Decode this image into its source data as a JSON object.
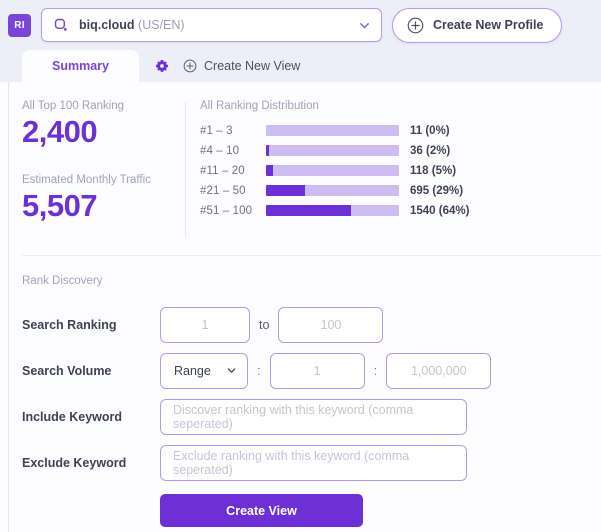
{
  "brand": {
    "logo_text": "RI",
    "accent": "#6d30d4",
    "accent_light": "#cdbdee",
    "border": "#b39ae8"
  },
  "topbar": {
    "profile_name": "biq.cloud",
    "profile_locale": "(US/EN)",
    "create_profile_label": "Create New Profile"
  },
  "tabs": {
    "active_label": "Summary",
    "create_view_label": "Create New View"
  },
  "summary": {
    "stats": [
      {
        "label": "All Top 100 Ranking",
        "value": "2,400"
      },
      {
        "label": "Estimated Monthly Traffic",
        "value": "5,507"
      }
    ]
  },
  "chart_data": {
    "type": "bar",
    "orientation": "horizontal",
    "title": "All Ranking Distribution",
    "xlabel": "",
    "ylabel": "",
    "grid": false,
    "legend": "none",
    "categories": [
      "#1 – 3",
      "#4 – 10",
      "#11 – 20",
      "#21 – 50",
      "#51 – 100"
    ],
    "values": [
      11,
      36,
      118,
      695,
      1540
    ],
    "percents": [
      0,
      2,
      5,
      29,
      64
    ],
    "total": 2400,
    "xlim": [
      0,
      100
    ],
    "value_labels": [
      "11 (0%)",
      "36 (2%)",
      "118 (5%)",
      "695 (29%)",
      "1540 (64%)"
    ],
    "bar_color": "#6d30d4",
    "track_color": "#cdbdee"
  },
  "discovery": {
    "title": "Rank Discovery",
    "search_ranking": {
      "label": "Search Ranking",
      "from_placeholder": "1",
      "to_separator": "to",
      "to_placeholder": "100"
    },
    "search_volume": {
      "label": "Search Volume",
      "mode_value": "Range",
      "separator": ":",
      "min_placeholder": "1",
      "max_placeholder": "1,000,000"
    },
    "include_keyword": {
      "label": "Include Keyword",
      "placeholder": "Discover ranking with this keyword (comma seperated)"
    },
    "exclude_keyword": {
      "label": "Exclude Keyword",
      "placeholder": "Exclude ranking with this keyword (comma seperated)"
    },
    "submit_label": "Create View"
  }
}
